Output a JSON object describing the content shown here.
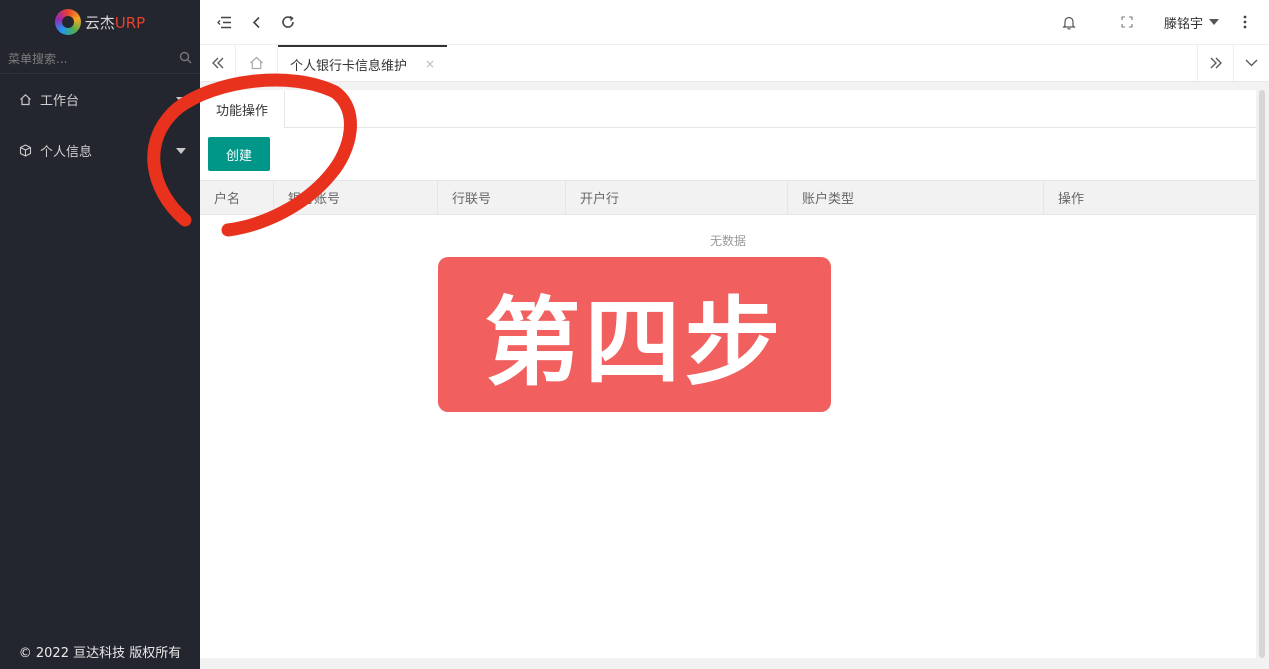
{
  "sidebar": {
    "logo_text_main": "云杰",
    "logo_text_accent": "URP",
    "search_placeholder": "菜单搜索...",
    "items": [
      {
        "label": "工作台",
        "icon": "home-icon"
      },
      {
        "label": "个人信息",
        "icon": "cube-icon"
      }
    ],
    "copyright": "© 2022 亘达科技 版权所有"
  },
  "topbar": {
    "user_name": "滕铭宇",
    "icons": [
      "menu-collapse-icon",
      "back-icon",
      "refresh-icon",
      "bell-icon",
      "fullscreen-icon",
      "more-icon"
    ]
  },
  "tabs": {
    "active_page": "个人银行卡信息维护",
    "close_symbol": "×"
  },
  "content": {
    "subtab": "功能操作",
    "create_button": "创建",
    "columns": [
      "户名",
      "银行账号",
      "行联号",
      "开户行",
      "账户类型",
      "操作"
    ],
    "empty_text": "无数据"
  },
  "overlay": {
    "step_label": "第四步",
    "accent_color": "#f1605f",
    "circle_color": "#e8321e"
  },
  "colors": {
    "sidebar_bg": "#23262e",
    "primary_button": "#009688"
  }
}
